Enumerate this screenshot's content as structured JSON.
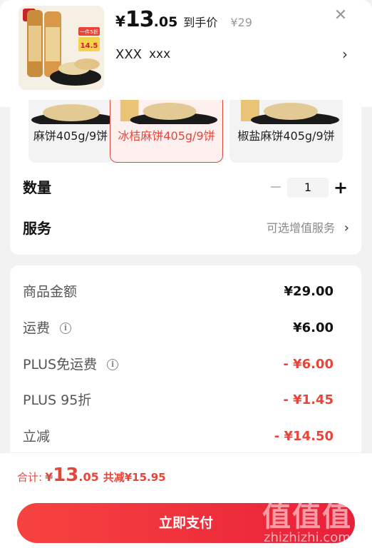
{
  "header": {
    "price_symbol": "¥",
    "price_integer": "13",
    "price_decimal": ".05",
    "price_tag": "到手价",
    "original_price": "¥29",
    "sku_primary": "XXX",
    "sku_secondary": "xxx",
    "close_icon": "close-icon",
    "thumb_badge_top": "一件5折",
    "thumb_badge_value": "14.5"
  },
  "variants": [
    {
      "label": "麻饼405g/9饼",
      "selected": false
    },
    {
      "label": "冰桔麻饼405g/9饼",
      "selected": true
    },
    {
      "label": "椒盐麻饼405g/9饼",
      "selected": false
    }
  ],
  "quantity": {
    "label": "数量",
    "value": "1",
    "minus_symbol": "−",
    "plus_symbol": "+"
  },
  "service": {
    "label": "服务",
    "value": "可选增值服务",
    "chevron": "›"
  },
  "cost": {
    "rows": [
      {
        "label": "商品金额",
        "value": "¥29.00",
        "info": false,
        "red": false
      },
      {
        "label": "运费",
        "value": "¥6.00",
        "info": true,
        "red": false
      },
      {
        "label": "PLUS免运费",
        "value": "- ¥6.00",
        "info": true,
        "red": true
      },
      {
        "label": "PLUS 95折",
        "value": "- ¥1.45",
        "info": false,
        "red": true
      },
      {
        "label": "立减",
        "value": "- ¥14.50",
        "info": false,
        "red": true
      }
    ]
  },
  "footer": {
    "total_label": "合计:",
    "total_symbol": "¥",
    "total_integer": "13",
    "total_decimal": ".05",
    "total_discount": "共减¥15.95",
    "pay_button": "立即支付"
  },
  "watermark": {
    "logo": "值值值",
    "text": "zhizhizhi.com"
  },
  "colors": {
    "accent": "#e8443a",
    "pay_gradient_start": "#f7433f",
    "pay_gradient_end": "#e8203a"
  }
}
